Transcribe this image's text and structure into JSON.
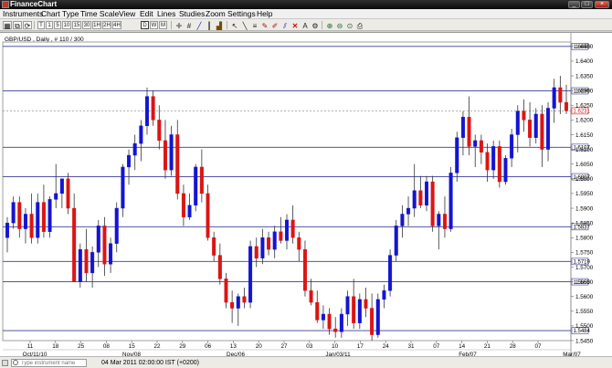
{
  "window": {
    "title": "FinanceChart"
  },
  "menu": [
    "Instruments",
    "Chart Type",
    "Time Scale",
    "View",
    "Edit",
    "Lines",
    "Studies",
    "Zoom",
    "Settings",
    "Help"
  ],
  "toolbar": {
    "timescales": [
      "T",
      "1",
      "5",
      "10",
      "15",
      "30",
      "1H",
      "2H",
      "4H",
      "D",
      "W",
      "M"
    ],
    "selected_timescale": "D",
    "icons": [
      "crosshair-icon",
      "hash-grid-icon",
      "line-chart-icon",
      "candle-chart-icon",
      "bar-chart-icon",
      "cursor-icon",
      "draw-icon",
      "delete-icon",
      "zoom-in-icon",
      "zoom-out-icon"
    ]
  },
  "chart_label": "GBP/USD , Daily , # 110 / 300",
  "status": {
    "search_placeholder": "Type instrument name",
    "datetime": "04 Mar 2011 02:00:00 IST (+0200)"
  },
  "colors": {
    "up": "#1414d2",
    "down": "#dc1414",
    "hline": "#3c3c9a",
    "current_price": "#cc1b1b"
  },
  "chart_data": {
    "type": "candlestick",
    "symbol": "GBP/USD",
    "ylim": [
      1.545,
      1.6465
    ],
    "ytick_labels": [
      "1.6450",
      "1.6400",
      "1.6350",
      "1.6300",
      "1.6250",
      "1.6200",
      "1.6150",
      "1.6100",
      "1.6050",
      "1.6000",
      "1.5950",
      "1.5900",
      "1.5850",
      "1.5800",
      "1.5750",
      "1.5700",
      "1.5650",
      "1.5600",
      "1.5550",
      "1.5500",
      "1.5450"
    ],
    "horizontal_lines": [
      1.645,
      1.6299,
      1.6107,
      1.6007,
      1.5837,
      1.5719,
      1.565,
      1.5484
    ],
    "horizontal_line_labels": [
      "1.6450",
      "1.6299",
      "1.6107",
      "1.6007",
      "1.5837",
      "1.5719",
      "1.5650",
      "1.5484"
    ],
    "current_price": "1.6231",
    "xtick_labels": [
      "11",
      "18",
      "25",
      "08",
      "15",
      "22",
      "29",
      "06",
      "13",
      "20",
      "27",
      "03",
      "10",
      "17",
      "24",
      "31",
      "07",
      "14",
      "21",
      "28",
      "07"
    ],
    "month_labels": [
      "Oct/11/10",
      "Nov/08",
      "Dec/06",
      "Jan/03/11",
      "Feb/07",
      "Mar/07"
    ],
    "candles": [
      {
        "o": 1.58,
        "h": 1.587,
        "l": 1.575,
        "c": 1.585
      },
      {
        "o": 1.585,
        "h": 1.594,
        "l": 1.583,
        "c": 1.592
      },
      {
        "o": 1.592,
        "h": 1.594,
        "l": 1.58,
        "c": 1.583
      },
      {
        "o": 1.583,
        "h": 1.59,
        "l": 1.578,
        "c": 1.588
      },
      {
        "o": 1.588,
        "h": 1.595,
        "l": 1.578,
        "c": 1.58
      },
      {
        "o": 1.58,
        "h": 1.595,
        "l": 1.578,
        "c": 1.592
      },
      {
        "o": 1.592,
        "h": 1.598,
        "l": 1.58,
        "c": 1.582
      },
      {
        "o": 1.582,
        "h": 1.594,
        "l": 1.58,
        "c": 1.593
      },
      {
        "o": 1.593,
        "h": 1.605,
        "l": 1.59,
        "c": 1.595
      },
      {
        "o": 1.595,
        "h": 1.6,
        "l": 1.59,
        "c": 1.6
      },
      {
        "o": 1.6,
        "h": 1.602,
        "l": 1.588,
        "c": 1.59
      },
      {
        "o": 1.59,
        "h": 1.595,
        "l": 1.565,
        "c": 1.565
      },
      {
        "o": 1.565,
        "h": 1.578,
        "l": 1.563,
        "c": 1.576
      },
      {
        "o": 1.576,
        "h": 1.583,
        "l": 1.565,
        "c": 1.568
      },
      {
        "o": 1.568,
        "h": 1.577,
        "l": 1.563,
        "c": 1.575
      },
      {
        "o": 1.575,
        "h": 1.586,
        "l": 1.57,
        "c": 1.584
      },
      {
        "o": 1.584,
        "h": 1.587,
        "l": 1.567,
        "c": 1.571
      },
      {
        "o": 1.571,
        "h": 1.58,
        "l": 1.568,
        "c": 1.578
      },
      {
        "o": 1.578,
        "h": 1.592,
        "l": 1.575,
        "c": 1.59
      },
      {
        "o": 1.59,
        "h": 1.605,
        "l": 1.587,
        "c": 1.604
      },
      {
        "o": 1.604,
        "h": 1.61,
        "l": 1.598,
        "c": 1.608
      },
      {
        "o": 1.608,
        "h": 1.615,
        "l": 1.603,
        "c": 1.612
      },
      {
        "o": 1.612,
        "h": 1.62,
        "l": 1.606,
        "c": 1.618
      },
      {
        "o": 1.618,
        "h": 1.631,
        "l": 1.615,
        "c": 1.628
      },
      {
        "o": 1.628,
        "h": 1.63,
        "l": 1.618,
        "c": 1.62
      },
      {
        "o": 1.62,
        "h": 1.625,
        "l": 1.61,
        "c": 1.613
      },
      {
        "o": 1.613,
        "h": 1.62,
        "l": 1.6,
        "c": 1.603
      },
      {
        "o": 1.603,
        "h": 1.618,
        "l": 1.601,
        "c": 1.615
      },
      {
        "o": 1.615,
        "h": 1.62,
        "l": 1.593,
        "c": 1.595
      },
      {
        "o": 1.595,
        "h": 1.598,
        "l": 1.584,
        "c": 1.587
      },
      {
        "o": 1.587,
        "h": 1.595,
        "l": 1.586,
        "c": 1.591
      },
      {
        "o": 1.591,
        "h": 1.605,
        "l": 1.589,
        "c": 1.604
      },
      {
        "o": 1.604,
        "h": 1.61,
        "l": 1.592,
        "c": 1.595
      },
      {
        "o": 1.595,
        "h": 1.598,
        "l": 1.579,
        "c": 1.58
      },
      {
        "o": 1.58,
        "h": 1.582,
        "l": 1.572,
        "c": 1.574
      },
      {
        "o": 1.574,
        "h": 1.578,
        "l": 1.564,
        "c": 1.566
      },
      {
        "o": 1.566,
        "h": 1.568,
        "l": 1.556,
        "c": 1.558
      },
      {
        "o": 1.558,
        "h": 1.562,
        "l": 1.551,
        "c": 1.556
      },
      {
        "o": 1.556,
        "h": 1.561,
        "l": 1.55,
        "c": 1.56
      },
      {
        "o": 1.56,
        "h": 1.563,
        "l": 1.556,
        "c": 1.558
      },
      {
        "o": 1.558,
        "h": 1.579,
        "l": 1.556,
        "c": 1.577
      },
      {
        "o": 1.577,
        "h": 1.58,
        "l": 1.57,
        "c": 1.573
      },
      {
        "o": 1.573,
        "h": 1.583,
        "l": 1.571,
        "c": 1.58
      },
      {
        "o": 1.58,
        "h": 1.582,
        "l": 1.574,
        "c": 1.576
      },
      {
        "o": 1.576,
        "h": 1.584,
        "l": 1.573,
        "c": 1.582
      },
      {
        "o": 1.582,
        "h": 1.587,
        "l": 1.578,
        "c": 1.579
      },
      {
        "o": 1.579,
        "h": 1.588,
        "l": 1.576,
        "c": 1.586
      },
      {
        "o": 1.586,
        "h": 1.591,
        "l": 1.578,
        "c": 1.58
      },
      {
        "o": 1.58,
        "h": 1.582,
        "l": 1.572,
        "c": 1.576
      },
      {
        "o": 1.576,
        "h": 1.579,
        "l": 1.56,
        "c": 1.562
      },
      {
        "o": 1.562,
        "h": 1.566,
        "l": 1.557,
        "c": 1.558
      },
      {
        "o": 1.558,
        "h": 1.562,
        "l": 1.551,
        "c": 1.552
      },
      {
        "o": 1.552,
        "h": 1.557,
        "l": 1.549,
        "c": 1.554
      },
      {
        "o": 1.554,
        "h": 1.556,
        "l": 1.547,
        "c": 1.549
      },
      {
        "o": 1.549,
        "h": 1.553,
        "l": 1.546,
        "c": 1.548
      },
      {
        "o": 1.548,
        "h": 1.556,
        "l": 1.546,
        "c": 1.554
      },
      {
        "o": 1.554,
        "h": 1.562,
        "l": 1.55,
        "c": 1.56
      },
      {
        "o": 1.56,
        "h": 1.566,
        "l": 1.549,
        "c": 1.551
      },
      {
        "o": 1.551,
        "h": 1.561,
        "l": 1.549,
        "c": 1.559
      },
      {
        "o": 1.559,
        "h": 1.563,
        "l": 1.553,
        "c": 1.556
      },
      {
        "o": 1.556,
        "h": 1.561,
        "l": 1.545,
        "c": 1.547
      },
      {
        "o": 1.547,
        "h": 1.561,
        "l": 1.546,
        "c": 1.559
      },
      {
        "o": 1.559,
        "h": 1.564,
        "l": 1.556,
        "c": 1.562
      },
      {
        "o": 1.562,
        "h": 1.576,
        "l": 1.56,
        "c": 1.574
      },
      {
        "o": 1.574,
        "h": 1.586,
        "l": 1.572,
        "c": 1.584
      },
      {
        "o": 1.584,
        "h": 1.591,
        "l": 1.58,
        "c": 1.588
      },
      {
        "o": 1.588,
        "h": 1.594,
        "l": 1.584,
        "c": 1.59
      },
      {
        "o": 1.59,
        "h": 1.605,
        "l": 1.587,
        "c": 1.596
      },
      {
        "o": 1.596,
        "h": 1.601,
        "l": 1.59,
        "c": 1.591
      },
      {
        "o": 1.591,
        "h": 1.601,
        "l": 1.589,
        "c": 1.599
      },
      {
        "o": 1.599,
        "h": 1.601,
        "l": 1.582,
        "c": 1.584
      },
      {
        "o": 1.584,
        "h": 1.589,
        "l": 1.576,
        "c": 1.588
      },
      {
        "o": 1.588,
        "h": 1.594,
        "l": 1.58,
        "c": 1.583
      },
      {
        "o": 1.583,
        "h": 1.604,
        "l": 1.582,
        "c": 1.602
      },
      {
        "o": 1.602,
        "h": 1.616,
        "l": 1.599,
        "c": 1.614
      },
      {
        "o": 1.614,
        "h": 1.623,
        "l": 1.608,
        "c": 1.621
      },
      {
        "o": 1.621,
        "h": 1.628,
        "l": 1.608,
        "c": 1.611
      },
      {
        "o": 1.611,
        "h": 1.615,
        "l": 1.604,
        "c": 1.613
      },
      {
        "o": 1.613,
        "h": 1.615,
        "l": 1.605,
        "c": 1.609
      },
      {
        "o": 1.609,
        "h": 1.612,
        "l": 1.599,
        "c": 1.603
      },
      {
        "o": 1.603,
        "h": 1.613,
        "l": 1.6,
        "c": 1.611
      },
      {
        "o": 1.611,
        "h": 1.613,
        "l": 1.597,
        "c": 1.599
      },
      {
        "o": 1.599,
        "h": 1.608,
        "l": 1.598,
        "c": 1.607
      },
      {
        "o": 1.607,
        "h": 1.617,
        "l": 1.604,
        "c": 1.615
      },
      {
        "o": 1.615,
        "h": 1.625,
        "l": 1.609,
        "c": 1.623
      },
      {
        "o": 1.623,
        "h": 1.627,
        "l": 1.616,
        "c": 1.62
      },
      {
        "o": 1.62,
        "h": 1.626,
        "l": 1.611,
        "c": 1.614
      },
      {
        "o": 1.614,
        "h": 1.624,
        "l": 1.612,
        "c": 1.622
      },
      {
        "o": 1.622,
        "h": 1.625,
        "l": 1.604,
        "c": 1.61
      },
      {
        "o": 1.61,
        "h": 1.626,
        "l": 1.606,
        "c": 1.624
      },
      {
        "o": 1.624,
        "h": 1.634,
        "l": 1.619,
        "c": 1.631
      },
      {
        "o": 1.631,
        "h": 1.635,
        "l": 1.622,
        "c": 1.626
      },
      {
        "o": 1.626,
        "h": 1.632,
        "l": 1.622,
        "c": 1.6231
      }
    ]
  }
}
